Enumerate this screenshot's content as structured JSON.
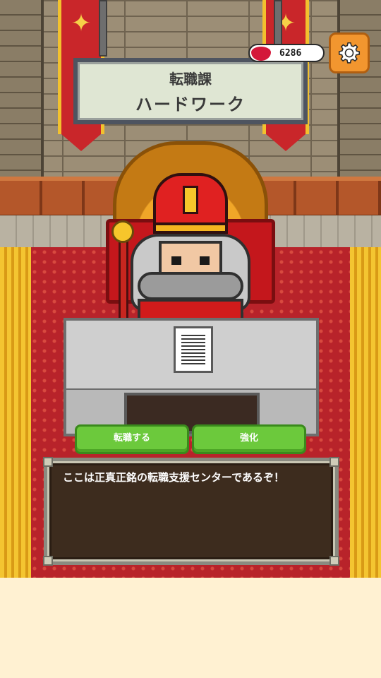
{
  "title_sign": {
    "line1": "転職課",
    "line2": "ハードワーク"
  },
  "currency": {
    "icon": "gem-icon",
    "value": "6286",
    "color": "#d4183a"
  },
  "settings": {
    "icon": "gear-icon"
  },
  "actions": {
    "change_job_label": "転職する",
    "upgrade_label": "強化"
  },
  "dialog": {
    "text": "ここは正真正銘の転職支援センターであるぞ！"
  },
  "colors": {
    "carpet": "#b8232a",
    "button_green": "#6cc93c",
    "settings_orange": "#f2962f",
    "bottom_bg": "#fff1d2"
  }
}
